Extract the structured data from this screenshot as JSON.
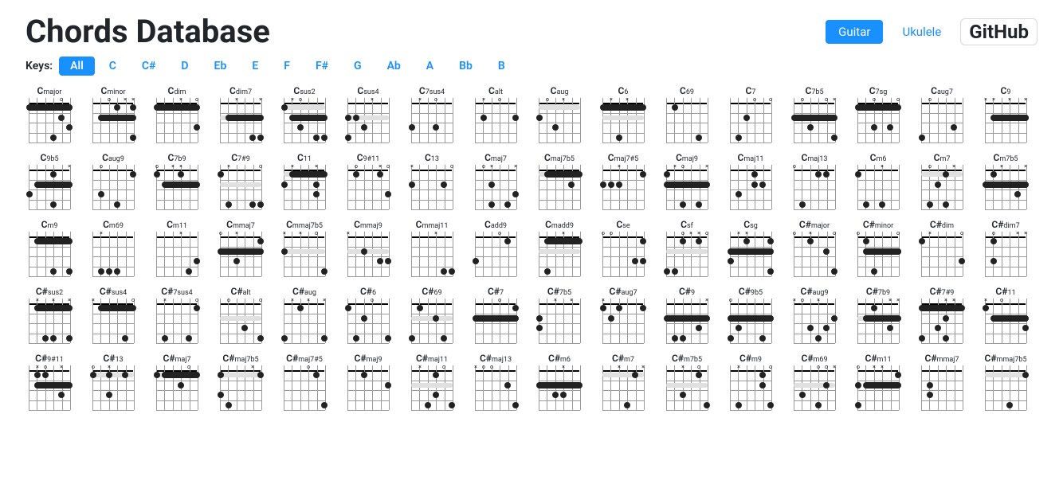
{
  "title": "Chords Database",
  "instruments": {
    "active": "Guitar",
    "other": "Ukulele"
  },
  "github": "GitHub",
  "keysLabel": "Keys:",
  "keys": [
    "All",
    "C",
    "C#",
    "D",
    "Eb",
    "E",
    "F",
    "F#",
    "G",
    "Ab",
    "A",
    "Bb",
    "B"
  ],
  "activeKey": "All",
  "chords": [
    {
      "root": "C",
      "suffix": "major"
    },
    {
      "root": "C",
      "suffix": "minor"
    },
    {
      "root": "C",
      "suffix": "dim"
    },
    {
      "root": "C",
      "suffix": "dim7"
    },
    {
      "root": "C",
      "suffix": "sus2"
    },
    {
      "root": "C",
      "suffix": "sus4"
    },
    {
      "root": "C",
      "suffix": "7sus4"
    },
    {
      "root": "C",
      "suffix": "alt"
    },
    {
      "root": "C",
      "suffix": "aug"
    },
    {
      "root": "C",
      "suffix": "6"
    },
    {
      "root": "C",
      "suffix": "69"
    },
    {
      "root": "C",
      "suffix": "7"
    },
    {
      "root": "C",
      "suffix": "7b5"
    },
    {
      "root": "C",
      "suffix": "7sg"
    },
    {
      "root": "C",
      "suffix": "aug7"
    },
    {
      "root": "C",
      "suffix": "9"
    },
    {
      "root": "C",
      "suffix": "9b5"
    },
    {
      "root": "C",
      "suffix": "aug9"
    },
    {
      "root": "C",
      "suffix": "7b9"
    },
    {
      "root": "C",
      "suffix": "7#9"
    },
    {
      "root": "C",
      "suffix": "11"
    },
    {
      "root": "C",
      "suffix": "9#11"
    },
    {
      "root": "C",
      "suffix": "13"
    },
    {
      "root": "C",
      "suffix": "maj7"
    },
    {
      "root": "C",
      "suffix": "maj7b5"
    },
    {
      "root": "C",
      "suffix": "maj7#5"
    },
    {
      "root": "C",
      "suffix": "maj9"
    },
    {
      "root": "C",
      "suffix": "maj11"
    },
    {
      "root": "C",
      "suffix": "maj13"
    },
    {
      "root": "C",
      "suffix": "m6"
    },
    {
      "root": "C",
      "suffix": "m7"
    },
    {
      "root": "C",
      "suffix": "m7b5"
    },
    {
      "root": "C",
      "suffix": "m9"
    },
    {
      "root": "C",
      "suffix": "m69"
    },
    {
      "root": "C",
      "suffix": "m11"
    },
    {
      "root": "C",
      "suffix": "mmaj7"
    },
    {
      "root": "C",
      "suffix": "mmaj7b5"
    },
    {
      "root": "C",
      "suffix": "mmaj9"
    },
    {
      "root": "C",
      "suffix": "mmaj11"
    },
    {
      "root": "C",
      "suffix": "add9"
    },
    {
      "root": "C",
      "suffix": "madd9"
    },
    {
      "root": "C",
      "suffix": "se"
    },
    {
      "root": "C",
      "suffix": "sf"
    },
    {
      "root": "C",
      "suffix": "sg"
    },
    {
      "root": "C#",
      "suffix": "major"
    },
    {
      "root": "C#",
      "suffix": "minor"
    },
    {
      "root": "C#",
      "suffix": "dim"
    },
    {
      "root": "C#",
      "suffix": "dim7"
    },
    {
      "root": "C#",
      "suffix": "sus2"
    },
    {
      "root": "C#",
      "suffix": "sus4"
    },
    {
      "root": "C#",
      "suffix": "7sus4"
    },
    {
      "root": "C#",
      "suffix": "alt"
    },
    {
      "root": "C#",
      "suffix": "aug"
    },
    {
      "root": "C#",
      "suffix": "6"
    },
    {
      "root": "C#",
      "suffix": "69"
    },
    {
      "root": "C#",
      "suffix": "7"
    },
    {
      "root": "C#",
      "suffix": "7b5"
    },
    {
      "root": "C#",
      "suffix": "aug7"
    },
    {
      "root": "C#",
      "suffix": "9"
    },
    {
      "root": "C#",
      "suffix": "9b5"
    },
    {
      "root": "C#",
      "suffix": "aug9"
    },
    {
      "root": "C#",
      "suffix": "7b9"
    },
    {
      "root": "C#",
      "suffix": "7#9"
    },
    {
      "root": "C#",
      "suffix": "11"
    },
    {
      "root": "C#",
      "suffix": "9#11"
    },
    {
      "root": "C#",
      "suffix": "13"
    },
    {
      "root": "C#",
      "suffix": "maj7"
    },
    {
      "root": "C#",
      "suffix": "maj7b5"
    },
    {
      "root": "C#",
      "suffix": "maj7#5"
    },
    {
      "root": "C#",
      "suffix": "maj9"
    },
    {
      "root": "C#",
      "suffix": "maj11"
    },
    {
      "root": "C#",
      "suffix": "maj13"
    },
    {
      "root": "C#",
      "suffix": "m6"
    },
    {
      "root": "C#",
      "suffix": "m7"
    },
    {
      "root": "C#",
      "suffix": "m7b5"
    },
    {
      "root": "C#",
      "suffix": "m9"
    },
    {
      "root": "C#",
      "suffix": "m69"
    },
    {
      "root": "C#",
      "suffix": "m11"
    },
    {
      "root": "C#",
      "suffix": "mmaj7"
    },
    {
      "root": "C#",
      "suffix": "mmaj7b5"
    }
  ]
}
